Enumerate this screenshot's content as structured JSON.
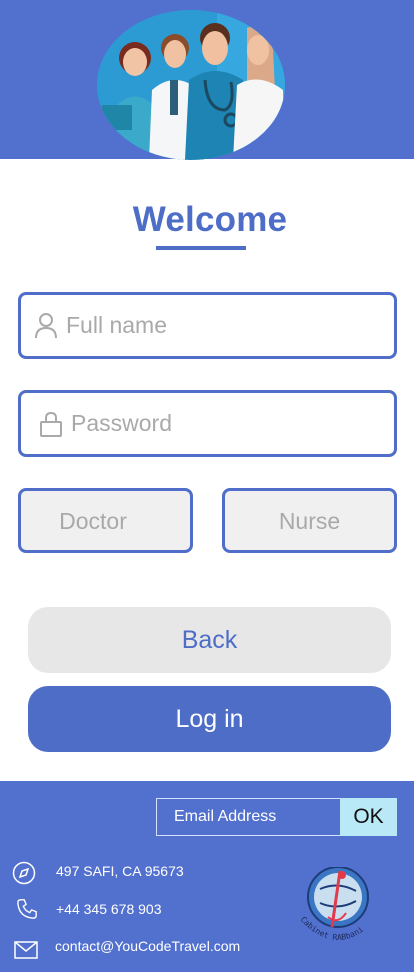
{
  "header": {
    "illustration": "medical-staff-illustration"
  },
  "welcome": {
    "title": "Welcome"
  },
  "form": {
    "fullname_placeholder": "Full name",
    "password_placeholder": "Password",
    "roles": [
      "Doctor",
      "Nurse"
    ]
  },
  "buttons": {
    "back": "Back",
    "login": "Log in"
  },
  "footer": {
    "email_placeholder": "Email Address",
    "ok_label": "OK",
    "address": "497  SAFI, CA 95673",
    "phone": "+44 345 678 903",
    "email": "contact@YouCodeTravel.com",
    "logo_text": "Cabinet RABbani"
  },
  "colors": {
    "brand": "#5270cd",
    "accent": "#4d6dc6",
    "ok": "#b9e9f6"
  },
  "icons": {
    "user": "user-icon",
    "lock": "lock-icon",
    "compass": "compass-icon",
    "phone": "phone-icon",
    "mail": "mail-icon"
  }
}
